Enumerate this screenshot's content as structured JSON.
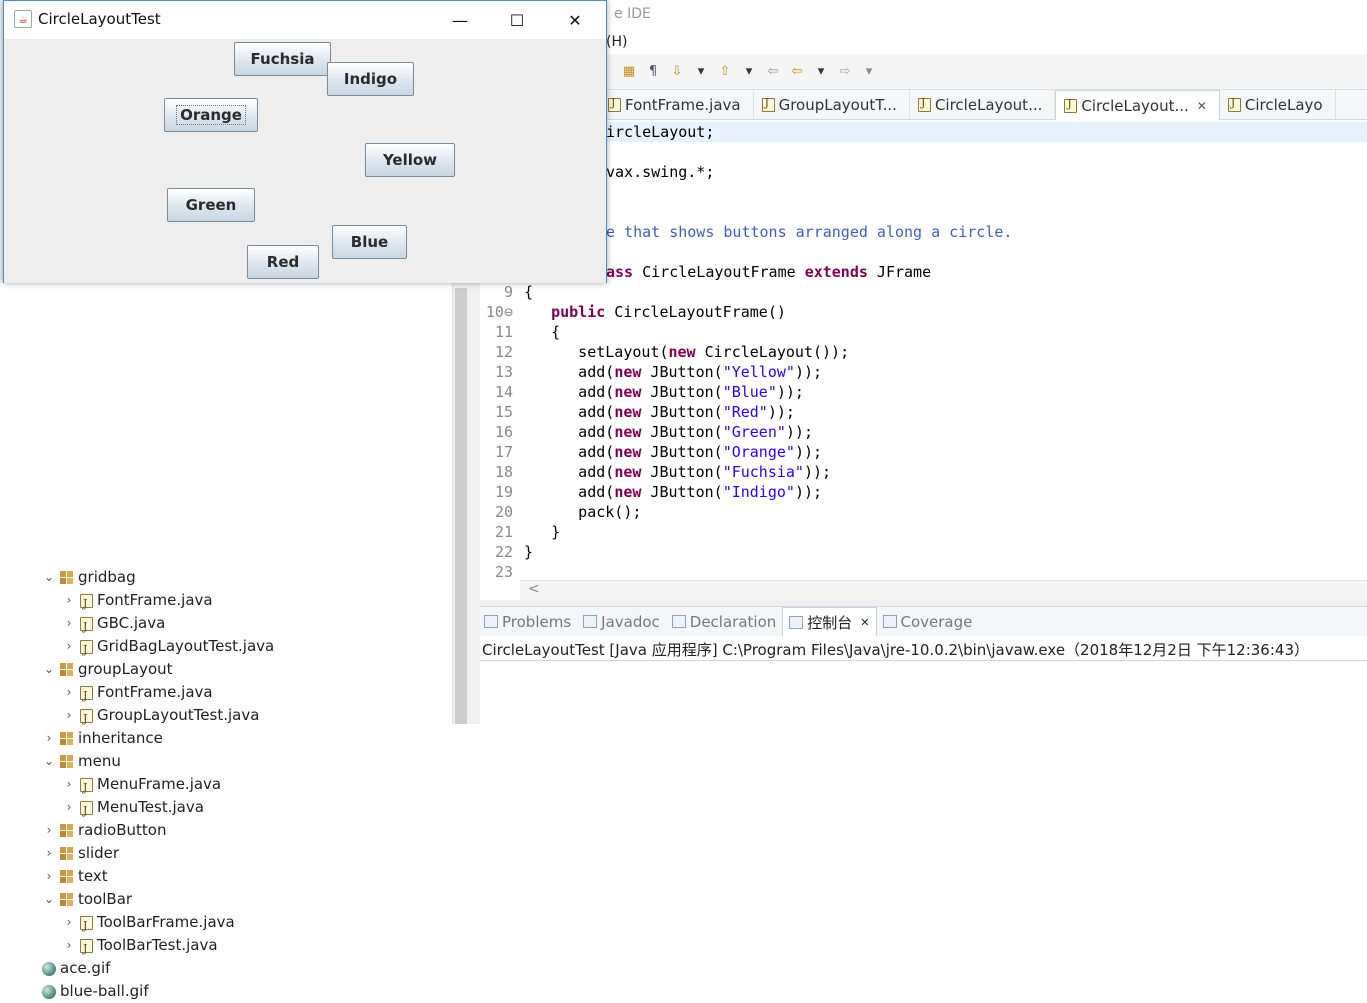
{
  "ide": {
    "title_fragment": "e IDE",
    "menu_fragment": "(H)",
    "tabs": [
      {
        "label": "FontFrame.java",
        "active": false
      },
      {
        "label": "GroupLayoutT...",
        "active": false
      },
      {
        "label": "CircleLayout...",
        "active": false
      },
      {
        "label": "CircleLayout...",
        "active": true,
        "close": "✕"
      },
      {
        "label": "CircleLayo",
        "active": false
      }
    ],
    "code": [
      {
        "num": "",
        "html": "<span>ircleLayout;</span>"
      },
      {
        "num": "",
        "html": ""
      },
      {
        "num": "",
        "html": "<span>vax.swing.*;</span>"
      },
      {
        "num": "",
        "html": ""
      },
      {
        "num": "",
        "html": ""
      },
      {
        "num": "",
        "html": "<span class=\"cmt\">e that shows buttons arranged along a circle.</span>"
      },
      {
        "num": "",
        "html": ""
      },
      {
        "num": "",
        "html": "<span class=\"kw\">ass</span> CircleLayoutFrame <span class=\"kw\">extends</span> JFrame"
      },
      {
        "num": "9",
        "html": "{"
      },
      {
        "num": "10⊖",
        "html": "   <span class=\"kw\">public</span> CircleLayoutFrame()"
      },
      {
        "num": "11",
        "html": "   {"
      },
      {
        "num": "12",
        "html": "      setLayout(<span class=\"kw\">new</span> CircleLayout());"
      },
      {
        "num": "13",
        "html": "      add(<span class=\"kw\">new</span> JButton(<span class=\"str\">\"Yellow\"</span>));"
      },
      {
        "num": "14",
        "html": "      add(<span class=\"kw\">new</span> JButton(<span class=\"str\">\"Blue\"</span>));"
      },
      {
        "num": "15",
        "html": "      add(<span class=\"kw\">new</span> JButton(<span class=\"str\">\"Red\"</span>));"
      },
      {
        "num": "16",
        "html": "      add(<span class=\"kw\">new</span> JButton(<span class=\"str\">\"Green\"</span>));"
      },
      {
        "num": "17",
        "html": "      add(<span class=\"kw\">new</span> JButton(<span class=\"str\">\"Orange\"</span>));"
      },
      {
        "num": "18",
        "html": "      add(<span class=\"kw\">new</span> JButton(<span class=\"str\">\"Fuchsia\"</span>));"
      },
      {
        "num": "19",
        "html": "      add(<span class=\"kw\">new</span> JButton(<span class=\"str\">\"Indigo\"</span>));"
      },
      {
        "num": "20",
        "html": "      pack();"
      },
      {
        "num": "21",
        "html": "   }"
      },
      {
        "num": "22",
        "html": "}"
      },
      {
        "num": "23",
        "html": ""
      }
    ],
    "bottom_tabs": [
      {
        "label": "Problems",
        "active": false
      },
      {
        "label": "Javadoc",
        "active": false
      },
      {
        "label": "Declaration",
        "active": false
      },
      {
        "label": "控制台",
        "active": true
      },
      {
        "label": "Coverage",
        "active": false
      }
    ],
    "console_text": "CircleLayoutTest [Java 应用程序] C:\\Program Files\\Java\\jre-10.0.2\\bin\\javaw.exe（2018年12月2日 下午12:36:43）",
    "explorer": [
      {
        "label": "gridbag",
        "type": "package",
        "level": 1,
        "expanded": true
      },
      {
        "label": "FontFrame.java",
        "type": "java",
        "level": 2
      },
      {
        "label": "GBC.java",
        "type": "java",
        "level": 2
      },
      {
        "label": "GridBagLayoutTest.java",
        "type": "java",
        "level": 2
      },
      {
        "label": "groupLayout",
        "type": "package",
        "level": 1,
        "expanded": true
      },
      {
        "label": "FontFrame.java",
        "type": "java",
        "level": 2
      },
      {
        "label": "GroupLayoutTest.java",
        "type": "java",
        "level": 2
      },
      {
        "label": "inheritance",
        "type": "package",
        "level": 1,
        "expanded": false
      },
      {
        "label": "menu",
        "type": "package",
        "level": 1,
        "expanded": true
      },
      {
        "label": "MenuFrame.java",
        "type": "java",
        "level": 2
      },
      {
        "label": "MenuTest.java",
        "type": "java",
        "level": 2
      },
      {
        "label": "radioButton",
        "type": "package",
        "level": 1,
        "expanded": false
      },
      {
        "label": "slider",
        "type": "package",
        "level": 1,
        "expanded": false
      },
      {
        "label": "text",
        "type": "package",
        "level": 1,
        "expanded": false
      },
      {
        "label": "toolBar",
        "type": "package",
        "level": 1,
        "expanded": true
      },
      {
        "label": "ToolBarFrame.java",
        "type": "java",
        "level": 2
      },
      {
        "label": "ToolBarTest.java",
        "type": "java",
        "level": 2
      },
      {
        "label": "ace.gif",
        "type": "file",
        "level": 0
      },
      {
        "label": "blue-ball.gif",
        "type": "file",
        "level": 0
      }
    ]
  },
  "window": {
    "title": "CircleLayoutTest",
    "minimize": "—",
    "maximize": "☐",
    "close": "✕",
    "buttons": [
      {
        "name": "fuchsia",
        "label": "Fuchsia"
      },
      {
        "name": "indigo",
        "label": "Indigo"
      },
      {
        "name": "orange",
        "label": "Orange",
        "focused": true
      },
      {
        "name": "yellow",
        "label": "Yellow"
      },
      {
        "name": "green",
        "label": "Green"
      },
      {
        "name": "blue",
        "label": "Blue"
      },
      {
        "name": "red",
        "label": "Red"
      }
    ]
  }
}
